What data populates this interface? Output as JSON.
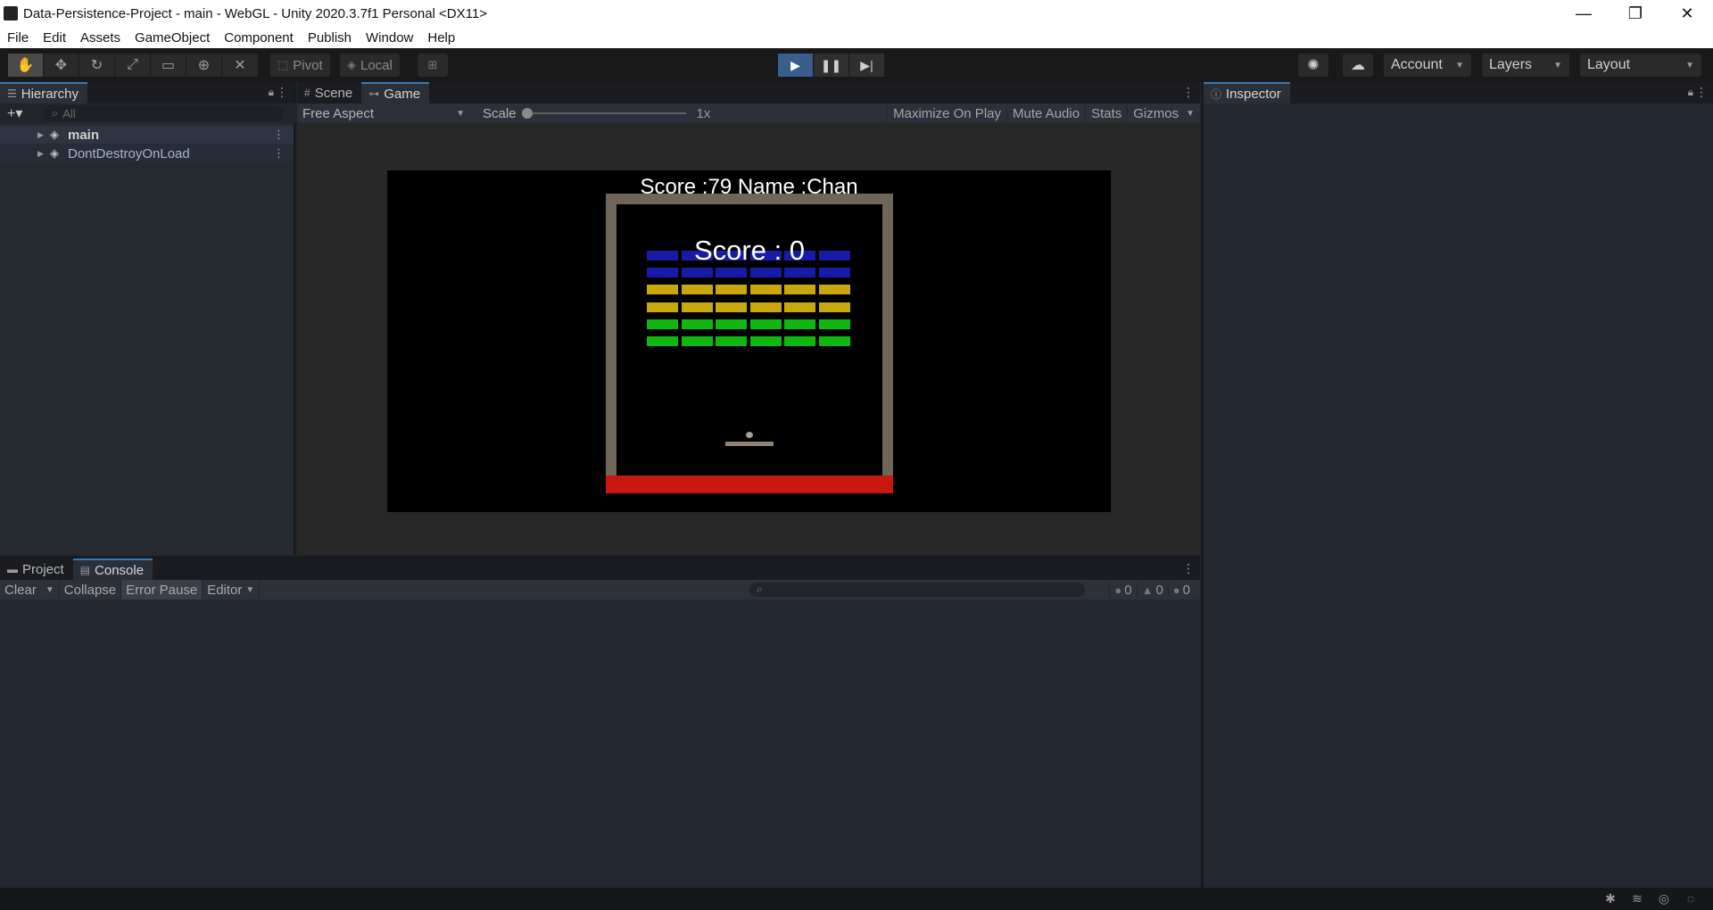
{
  "window": {
    "title": "Data-Persistence-Project - main - WebGL - Unity 2020.3.7f1 Personal <DX11>",
    "controls": [
      "—",
      "❐",
      "✕"
    ]
  },
  "menu": [
    "File",
    "Edit",
    "Assets",
    "GameObject",
    "Component",
    "Publish",
    "Window",
    "Help"
  ],
  "toolbar": {
    "pivot": "Pivot",
    "local": "Local",
    "account": "Account",
    "layers": "Layers",
    "layout": "Layout"
  },
  "hierarchy": {
    "tab": "Hierarchy",
    "search_placeholder": "All",
    "items": [
      {
        "label": "main"
      },
      {
        "label": "DontDestroyOnLoad"
      }
    ]
  },
  "center_tabs": {
    "scene": "Scene",
    "game": "Game"
  },
  "game_toolbar": {
    "aspect": "Free Aspect",
    "scale_label": "Scale",
    "scale_value": "1x",
    "maximize": "Maximize On Play",
    "mute": "Mute Audio",
    "stats": "Stats",
    "gizmos": "Gizmos"
  },
  "game": {
    "best_score_text": "Score :79   Name :Chan",
    "current_score_text": "Score : 0",
    "brick_rows": [
      "#1a1aa8",
      "#1a1aa8",
      "#c9a80f",
      "#c9a80f",
      "#0fb80f",
      "#0fb80f"
    ],
    "bricks_per_row": 6
  },
  "inspector": {
    "tab": "Inspector"
  },
  "bottom_tabs": {
    "project": "Project",
    "console": "Console"
  },
  "console_toolbar": {
    "clear": "Clear",
    "collapse": "Collapse",
    "error_pause": "Error Pause",
    "editor": "Editor",
    "log_count": "0",
    "warning_count": "0",
    "error_count": "0"
  },
  "colors": {
    "accent": "#3a79bb",
    "play_active": "#3a5e8c",
    "deathzone": "#c7170f",
    "wall": "#6f6558"
  }
}
